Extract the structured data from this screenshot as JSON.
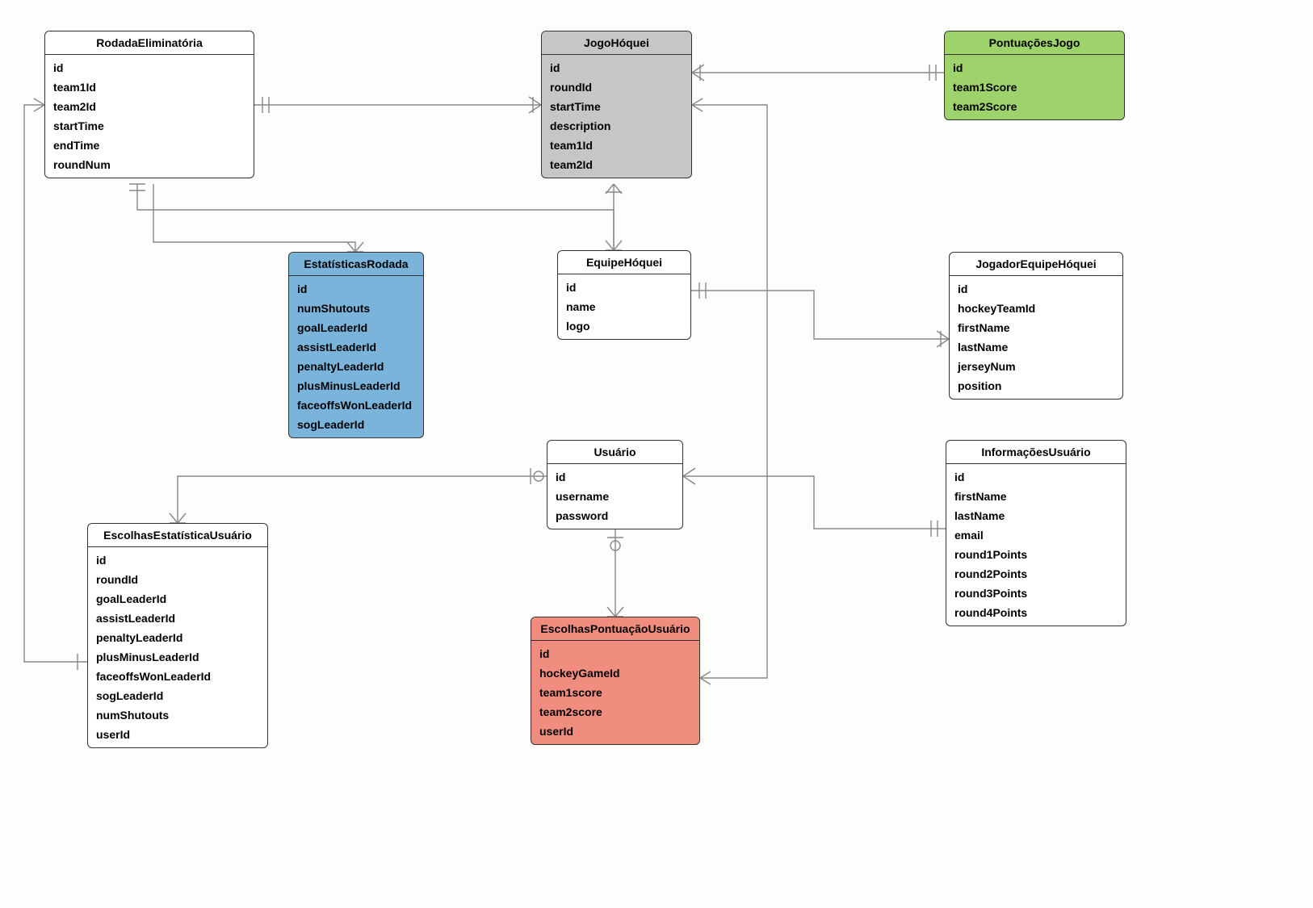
{
  "entities": {
    "rodada": {
      "title": "RodadaEliminatória",
      "attrs": [
        "id",
        "team1Id",
        "team2Id",
        "startTime",
        "endTime",
        "roundNum"
      ]
    },
    "jogo": {
      "title": "JogoHóquei",
      "attrs": [
        "id",
        "roundId",
        "startTime",
        "description",
        "team1Id",
        "team2Id"
      ]
    },
    "pontuacoes": {
      "title": "PontuaçõesJogo",
      "attrs": [
        "id",
        "team1Score",
        "team2Score"
      ]
    },
    "estatisticas": {
      "title": "EstatísticasRodada",
      "attrs": [
        "id",
        "numShutouts",
        "goalLeaderId",
        "assistLeaderId",
        "penaltyLeaderId",
        "plusMinusLeaderId",
        "faceoffsWonLeaderId",
        "sogLeaderId"
      ]
    },
    "equipe": {
      "title": "EquipeHóquei",
      "attrs": [
        "id",
        "name",
        "logo"
      ]
    },
    "jogador": {
      "title": "JogadorEquipeHóquei",
      "attrs": [
        "id",
        "hockeyTeamId",
        "firstName",
        "lastName",
        "jerseyNum",
        "position"
      ]
    },
    "usuario": {
      "title": "Usuário",
      "attrs": [
        "id",
        "username",
        "password"
      ]
    },
    "infoUsuario": {
      "title": "InformaçõesUsuário",
      "attrs": [
        "id",
        "firstName",
        "lastName",
        "email",
        "round1Points",
        "round2Points",
        "round3Points",
        "round4Points"
      ]
    },
    "escolhasEst": {
      "title": "EscolhasEstatísticaUsuário",
      "attrs": [
        "id",
        "roundId",
        "goalLeaderId",
        "assistLeaderId",
        "penaltyLeaderId",
        "plusMinusLeaderId",
        "faceoffsWonLeaderId",
        "sogLeaderId",
        "numShutouts",
        "userId"
      ]
    },
    "escolhasPont": {
      "title": "EscolhasPontuaçãoUsuário",
      "attrs": [
        "id",
        "hockeyGameId",
        "team1score",
        "team2score",
        "userId"
      ]
    }
  }
}
